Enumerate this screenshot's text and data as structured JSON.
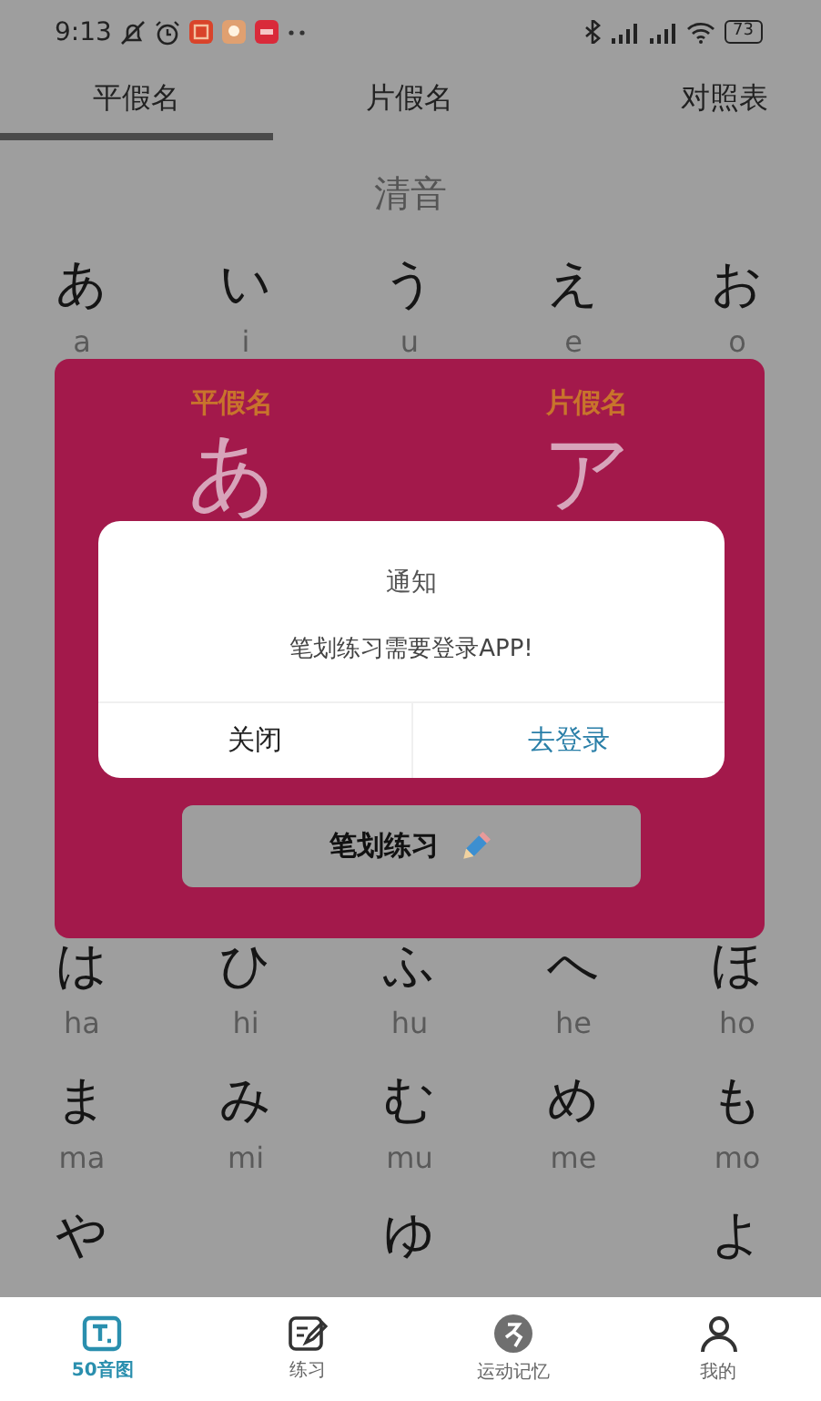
{
  "status_bar": {
    "time": "9:13",
    "battery": "73"
  },
  "tabs": [
    {
      "label": "平假名",
      "selected": true
    },
    {
      "label": "片假名",
      "selected": false
    },
    {
      "label": "对照表",
      "selected": false
    }
  ],
  "section_title": "清音",
  "kana_rows": [
    {
      "cells": [
        {
          "kana": "あ",
          "romaji": "a"
        },
        {
          "kana": "い",
          "romaji": "i"
        },
        {
          "kana": "う",
          "romaji": "u"
        },
        {
          "kana": "え",
          "romaji": "e"
        },
        {
          "kana": "お",
          "romaji": "o"
        }
      ]
    },
    {
      "cells": [
        {
          "kana": "は",
          "romaji": "ha"
        },
        {
          "kana": "ひ",
          "romaji": "hi"
        },
        {
          "kana": "ふ",
          "romaji": "hu"
        },
        {
          "kana": "へ",
          "romaji": "he"
        },
        {
          "kana": "ほ",
          "romaji": "ho"
        }
      ]
    },
    {
      "cells": [
        {
          "kana": "ま",
          "romaji": "ma"
        },
        {
          "kana": "み",
          "romaji": "mi"
        },
        {
          "kana": "む",
          "romaji": "mu"
        },
        {
          "kana": "め",
          "romaji": "me"
        },
        {
          "kana": "も",
          "romaji": "mo"
        }
      ]
    },
    {
      "cells": [
        {
          "kana": "や"
        },
        null,
        {
          "kana": "ゆ"
        },
        null,
        {
          "kana": "よ"
        }
      ]
    }
  ],
  "detail_card": {
    "labels": [
      "平假名",
      "片假名"
    ],
    "chars": [
      "あ",
      "ア"
    ],
    "practice_button": "笔划练习"
  },
  "dialog": {
    "title": "通知",
    "message": "笔划练习需要登录APP!",
    "buttons": [
      {
        "label": "关闭",
        "kind": "secondary"
      },
      {
        "label": "去登录",
        "kind": "primary"
      }
    ]
  },
  "bottom_nav": [
    {
      "label": "50音图",
      "selected": true
    },
    {
      "label": "练习",
      "selected": false
    },
    {
      "label": "运动记忆",
      "selected": false
    },
    {
      "label": "我的",
      "selected": false
    }
  ]
}
